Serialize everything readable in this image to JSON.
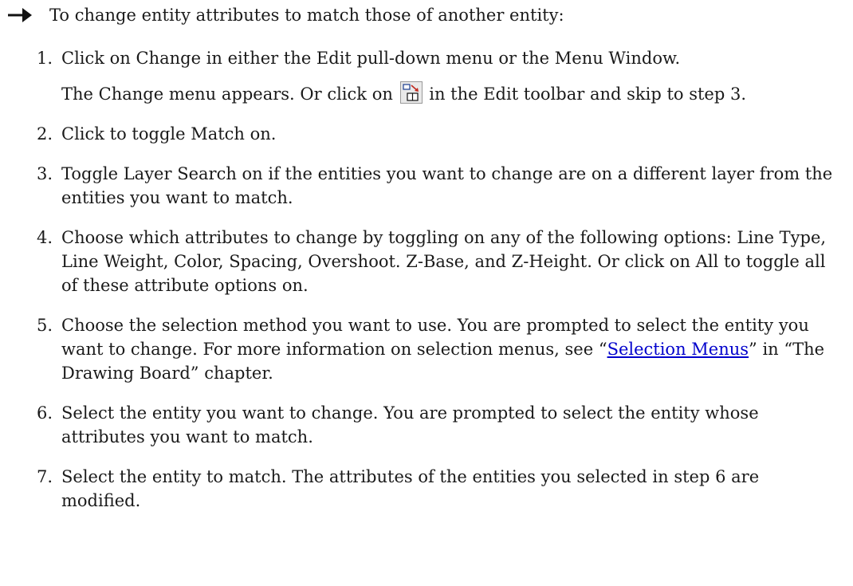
{
  "intro": "To change entity attributes to match those of another entity:",
  "steps": [
    {
      "num": "1.",
      "text": "Click on Change in either the Edit pull-down menu or the Menu Window."
    },
    {
      "num": "2.",
      "text": "Click to toggle Match on."
    },
    {
      "num": "3.",
      "text": "Toggle Layer Search on if the entities you want to change are on a different layer from the entities you want to match."
    },
    {
      "num": "4.",
      "text": "Choose which attributes to change by toggling on any of the following options: Line Type, Line Weight, Color, Spacing, Overshoot. Z-Base, and Z-Height. Or click on All to toggle all of these attribute options on."
    },
    {
      "num": "5.",
      "text": "Choose the selection method you want to use. You are prompted to select the entity you want to change. For more information on selection menus, see “",
      "link": "Selection Menus",
      "after": "” in “The Drawing Board” chapter."
    },
    {
      "num": "6.",
      "text": "Select the entity you want to change. You are prompted to select the entity whose attributes you want to match."
    },
    {
      "num": "7.",
      "text": "Select the entity to match. The attributes of the entities you selected in step 6 are modified."
    }
  ],
  "step1_sub": {
    "before": "The Change menu appears. Or click on",
    "icon": "change-match-toolbar-icon",
    "after": "in the Edit toolbar and skip to step 3."
  },
  "colors": {
    "link": "#0000cc",
    "text": "#1a1a1a"
  }
}
